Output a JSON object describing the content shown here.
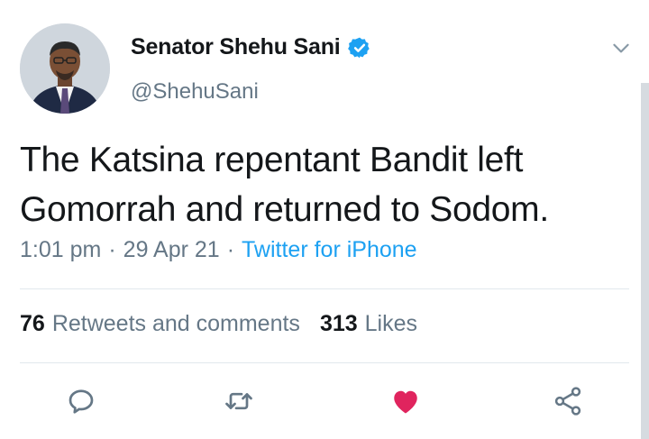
{
  "author": {
    "display_name": "Senator Shehu Sani",
    "handle": "@ShehuSani",
    "verified": true,
    "avatar_icon": "profile-photo"
  },
  "tweet": {
    "text": "The Katsina repentant Bandit left\nGomorrah and returned to Sodom.",
    "time": "1:01 pm",
    "separator": "·",
    "date": "29 Apr 21",
    "source": "Twitter for iPhone"
  },
  "stats": {
    "retweets_count": "76",
    "retweets_label": "Retweets and comments",
    "likes_count": "313",
    "likes_label": "Likes"
  },
  "actions": {
    "reply_icon": "reply-icon",
    "retweet_icon": "retweet-icon",
    "like_icon": "heart-icon",
    "like_active": true,
    "share_icon": "share-icon"
  },
  "colors": {
    "accent": "#1da1f2",
    "text": "#14171a",
    "secondary": "#657786",
    "like": "#e0245e",
    "divider": "#e1e8ed"
  }
}
